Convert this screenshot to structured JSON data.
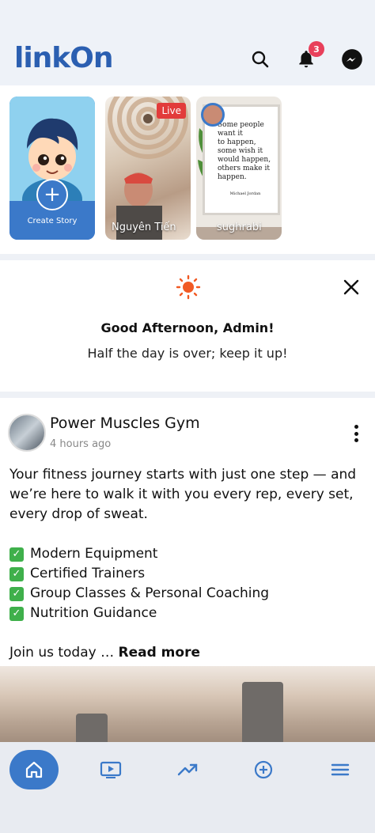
{
  "header": {
    "logo_text": "linkOn",
    "search_icon": "search-icon",
    "notification_icon": "bell-icon",
    "notification_count": "3",
    "messenger_icon": "messenger-icon",
    "accent_color": "#2b5fb1",
    "badge_color": "#e8405b"
  },
  "stories": {
    "items": [
      {
        "label": "Create Story",
        "type": "create"
      },
      {
        "label": "Nguyên Tiến",
        "type": "live",
        "badge": "Live"
      },
      {
        "label": "sughrabi",
        "type": "story"
      }
    ],
    "quote": {
      "lines": [
        "Some people",
        "want it",
        "to happen,",
        "some wish it",
        "would happen,",
        "others make it",
        "happen."
      ],
      "author": "Michael Jordan"
    }
  },
  "greeting": {
    "title": "Good Afternoon, Admin!",
    "subtitle": "Half the day is over; keep it up!"
  },
  "post": {
    "author": "Power Muscles Gym",
    "time": "4 hours ago",
    "intro": "Your fitness journey starts with just one step — and we’re here to walk it with you every rep, every set, every drop of sweat.",
    "features": [
      "Modern Equipment",
      "Certified Trainers",
      "Group Classes & Personal Coaching",
      "Nutrition Guidance"
    ],
    "outro": "Join us today …",
    "read_more": "Read more"
  },
  "bottom_nav": {
    "items": [
      {
        "icon": "home-icon",
        "active": true
      },
      {
        "icon": "video-icon",
        "active": false
      },
      {
        "icon": "trending-icon",
        "active": false
      },
      {
        "icon": "add-circle-icon",
        "active": false
      },
      {
        "icon": "menu-icon",
        "active": false
      }
    ],
    "active_color": "#3b79c9"
  }
}
